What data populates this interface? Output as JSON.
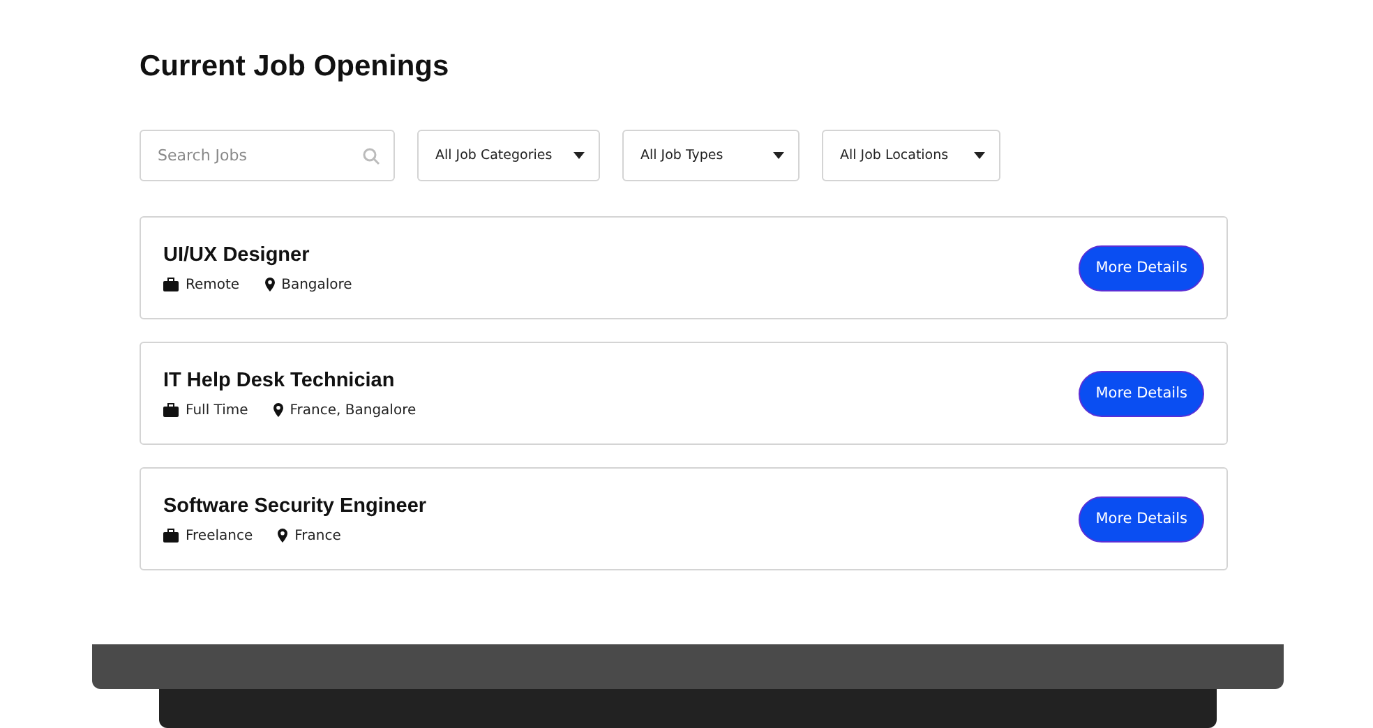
{
  "title": "Current Job Openings",
  "search": {
    "placeholder": "Search Jobs"
  },
  "filters": [
    "All Job Categories",
    "All Job Types",
    "All Job Locations"
  ],
  "jobs": [
    {
      "title": "UI/UX Designer",
      "type": "Remote",
      "location": "Bangalore",
      "button": "More Details"
    },
    {
      "title": "IT Help Desk Technician",
      "type": "Full Time",
      "location": "France, Bangalore",
      "button": "More Details"
    },
    {
      "title": "Software Security Engineer",
      "type": "Freelance",
      "location": "France",
      "button": "More Details"
    }
  ]
}
